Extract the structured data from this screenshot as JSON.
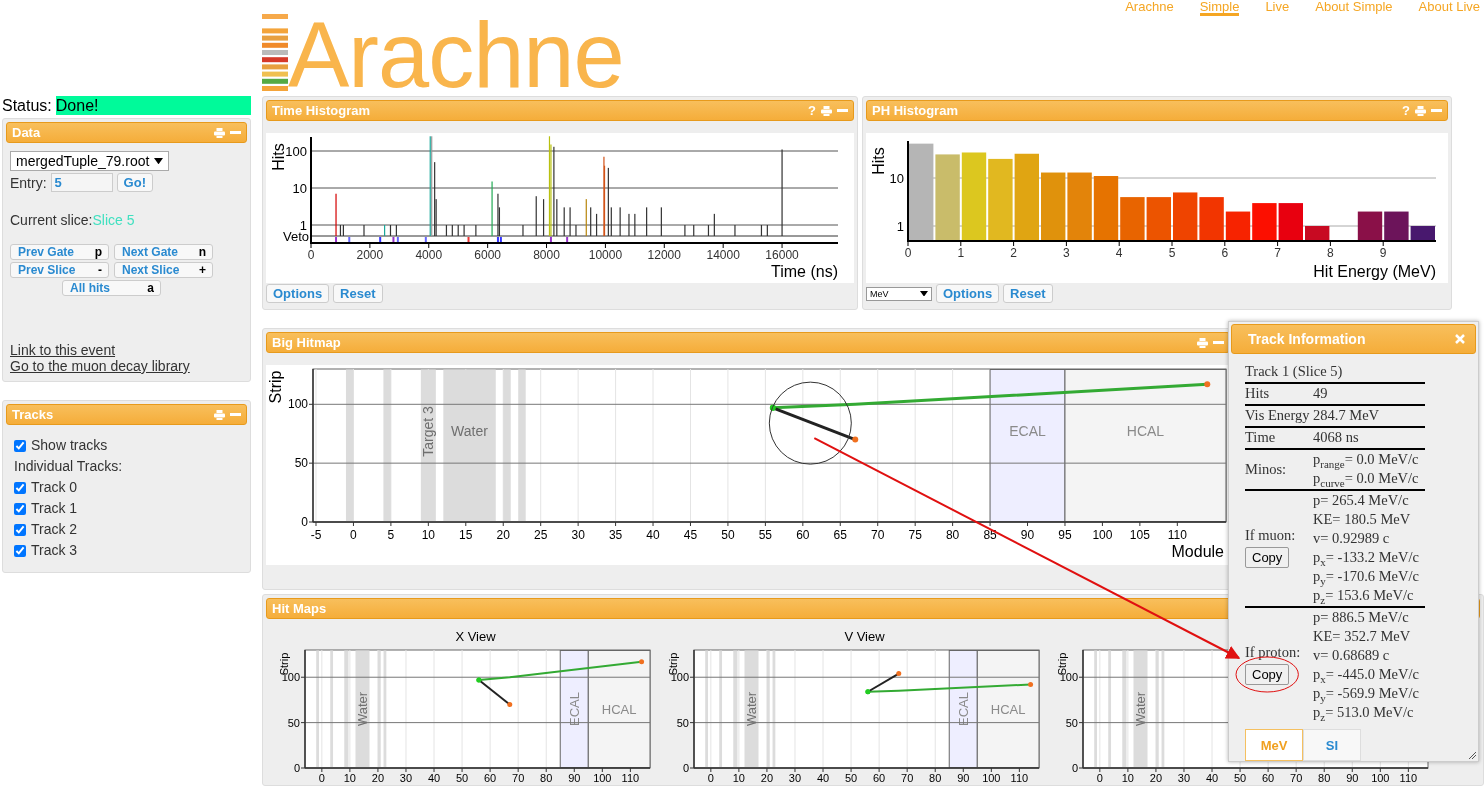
{
  "nav": [
    {
      "label": "Arachne",
      "selected": false
    },
    {
      "label": "Simple",
      "selected": true
    },
    {
      "label": "Live",
      "selected": false
    },
    {
      "label": "About Simple",
      "selected": false
    },
    {
      "label": "About Live",
      "selected": false
    }
  ],
  "logo": {
    "text": "Arachne"
  },
  "status": {
    "label": "Status:",
    "value": "Done!"
  },
  "data_panel": {
    "title": "Data",
    "file": "mergedTuple_79.root",
    "entry_label": "Entry:",
    "entry": "5",
    "go": "Go!",
    "slice_label": "Current slice:",
    "slice": "Slice 5",
    "buttons": [
      {
        "label": "Prev Gate",
        "key": "p"
      },
      {
        "label": "Next Gate",
        "key": "n"
      },
      {
        "label": "Prev Slice",
        "key": "-"
      },
      {
        "label": "Next Slice",
        "key": "+"
      },
      {
        "label": "All hits",
        "key": "a"
      }
    ],
    "links": [
      "Link to this event",
      "Go to the muon decay library"
    ]
  },
  "tracks_panel": {
    "title": "Tracks",
    "show": {
      "label": "Show tracks",
      "checked": true
    },
    "individual_label": "Individual Tracks:",
    "tracks": [
      {
        "label": "Track 0",
        "checked": true
      },
      {
        "label": "Track 1",
        "checked": true
      },
      {
        "label": "Track 2",
        "checked": true
      },
      {
        "label": "Track 3",
        "checked": true
      }
    ]
  },
  "time_histogram": {
    "title": "Time Histogram",
    "help": "?",
    "buttons": [
      "Options",
      "Reset"
    ],
    "xlabel": "Time (ns)",
    "ylabel": "Hits",
    "x_ticks": [
      "0",
      "2000",
      "4000",
      "6000",
      "8000",
      "10000",
      "12000",
      "14000",
      "16000"
    ],
    "y_ticks": [
      "100",
      "10",
      "1"
    ],
    "veto_label": "Veto"
  },
  "ph_histogram": {
    "title": "PH Histogram",
    "help": "?",
    "unit": "MeV",
    "buttons": [
      "Options",
      "Reset"
    ],
    "xlabel": "Hit Energy (MeV)",
    "ylabel": "Hits",
    "x_ticks": [
      "0",
      "1",
      "2",
      "3",
      "4",
      "5",
      "6",
      "7",
      "8",
      "9"
    ],
    "y_ticks": [
      "10",
      "1"
    ]
  },
  "big_hitmap": {
    "title": "Big Hitmap",
    "xlabel": "Module",
    "ylabel": "Strip",
    "x_ticks": [
      "-5",
      "0",
      "5",
      "10",
      "15",
      "20",
      "25",
      "30",
      "35",
      "40",
      "45",
      "50",
      "55",
      "60",
      "65",
      "70",
      "75",
      "80",
      "85",
      "90",
      "95",
      "100",
      "105",
      "110"
    ],
    "y_ticks": [
      "100",
      "50",
      "0"
    ],
    "region_labels": [
      "Target 3",
      "Water",
      "ECAL",
      "HCAL"
    ]
  },
  "hit_maps": {
    "title": "Hit Maps",
    "views": [
      {
        "title": "X View",
        "ylabel": "Strip",
        "x_ticks": [
          "0",
          "10",
          "20",
          "30",
          "40",
          "50",
          "60",
          "70",
          "80",
          "90",
          "100",
          "110"
        ],
        "y_ticks": [
          "100",
          "50",
          "0"
        ],
        "region_labels": [
          "Water",
          "ECAL",
          "HCAL"
        ]
      },
      {
        "title": "V View",
        "ylabel": "Strip",
        "x_ticks": [
          "0",
          "10",
          "20",
          "30",
          "40",
          "50",
          "60",
          "70",
          "80",
          "90",
          "100",
          "110"
        ],
        "y_ticks": [
          "100",
          "50",
          "0"
        ],
        "region_labels": [
          "Water",
          "ECAL",
          "HCAL"
        ]
      },
      {
        "ylabel": "Strip",
        "x_ticks": [
          "0",
          "10",
          "20",
          "30",
          "40",
          "50",
          "60",
          "70",
          "80",
          "90",
          "100",
          "110"
        ],
        "y_ticks": [
          "100",
          "50",
          "0"
        ],
        "region_labels": [
          "Water"
        ]
      }
    ]
  },
  "track_info": {
    "title": "Track Information",
    "heading": "Track 1 (Slice 5)",
    "rows": [
      {
        "kind": "pair",
        "label": "Hits",
        "value": "49"
      },
      {
        "kind": "pair",
        "label": "Vis Energy",
        "value": "284.7 MeV"
      },
      {
        "kind": "pair",
        "label": "Time",
        "value": "4068 ns"
      },
      {
        "kind": "block",
        "label": "Minos:",
        "lines": [
          "p$_{range}$= 0.0 MeV/c",
          "p$_{curve}$= 0.0 MeV/c"
        ]
      },
      {
        "kind": "block",
        "label": "If muon:",
        "button": "Copy",
        "lines": [
          "p= 265.4 MeV/c",
          "KE= 180.5 MeV",
          "v= 0.92989 c",
          "p$_{x}$= -133.2 MeV/c",
          "p$_{y}$= -170.6 MeV/c",
          "p$_{z}$= 153.6 MeV/c"
        ]
      },
      {
        "kind": "block",
        "label": "If proton:",
        "button": "Copy",
        "lines": [
          "p= 886.5 MeV/c",
          "KE= 352.7 MeV",
          "v= 0.68689 c",
          "p$_{x}$= -445.0 MeV/c",
          "p$_{y}$= -569.9 MeV/c",
          "p$_{z}$= 513.0 MeV/c"
        ]
      }
    ],
    "units": [
      {
        "label": "MeV",
        "selected": true
      },
      {
        "label": "SI",
        "selected": false
      }
    ]
  },
  "markup": [
    {
      "kind": "circle"
    },
    {
      "kind": "arrow"
    },
    {
      "kind": "ellipse"
    }
  ]
}
